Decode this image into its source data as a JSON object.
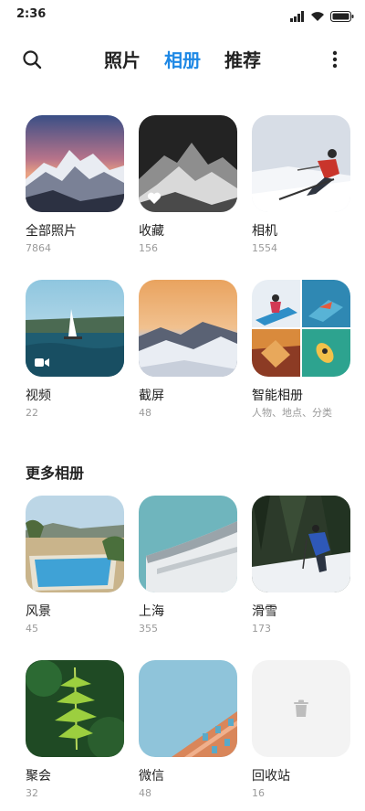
{
  "status": {
    "time": "2:36"
  },
  "tabs": [
    {
      "label": "照片"
    },
    {
      "label": "相册"
    },
    {
      "label": "推荐"
    }
  ],
  "albums": [
    {
      "name": "全部照片",
      "count": "7864"
    },
    {
      "name": "收藏",
      "count": "156"
    },
    {
      "name": "相机",
      "count": "1554"
    },
    {
      "name": "视频",
      "count": "22"
    },
    {
      "name": "截屏",
      "count": "48"
    },
    {
      "name": "智能相册",
      "count": "人物、地点、分类"
    }
  ],
  "more_section": {
    "title": "更多相册"
  },
  "more_albums": [
    {
      "name": "风景",
      "count": "45"
    },
    {
      "name": "上海",
      "count": "355"
    },
    {
      "name": "滑雪",
      "count": "173"
    },
    {
      "name": "聚会",
      "count": "32"
    },
    {
      "name": "微信",
      "count": "48"
    },
    {
      "name": "回收站",
      "count": "16"
    }
  ],
  "colors": {
    "accent": "#1e88e5",
    "text": "#222222",
    "subtext": "#9a9a9a"
  }
}
